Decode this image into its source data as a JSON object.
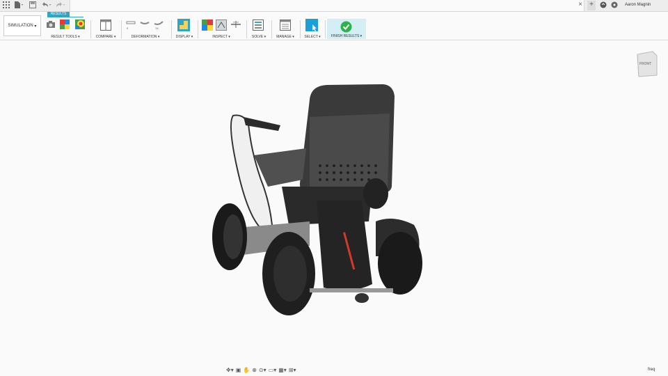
{
  "titlebar": {
    "apps_icon": "grid-icon",
    "file_icon": "file-icon",
    "save_icon": "save-icon",
    "undo_icon": "undo-icon",
    "redo_icon": "redo-icon",
    "close_tab_glyph": "×",
    "new_tab_glyph": "+",
    "user_name": "Aaron Magnin"
  },
  "ribbon": {
    "workspace_label": "SIMULATION",
    "active_tab": "RESULTS",
    "groups": {
      "result_tools": "RESULT TOOLS",
      "compare": "COMPARE",
      "deformation": "DEFORMATION",
      "display": "DISPLAY",
      "inspect": "INSPECT",
      "solve": "SOLVE",
      "manage": "MANAGE",
      "select": "SELECT",
      "finish": "FINISH RESULTS"
    },
    "deformation_labels": [
      "0",
      "",
      "1X"
    ]
  },
  "viewcube": {
    "face_label": "FRONT"
  },
  "status": {
    "freq_label": "freq"
  },
  "colors": {
    "accent": "#2ea6c6",
    "finish_green": "#2db34a",
    "select_blue": "#1aa0d8"
  }
}
